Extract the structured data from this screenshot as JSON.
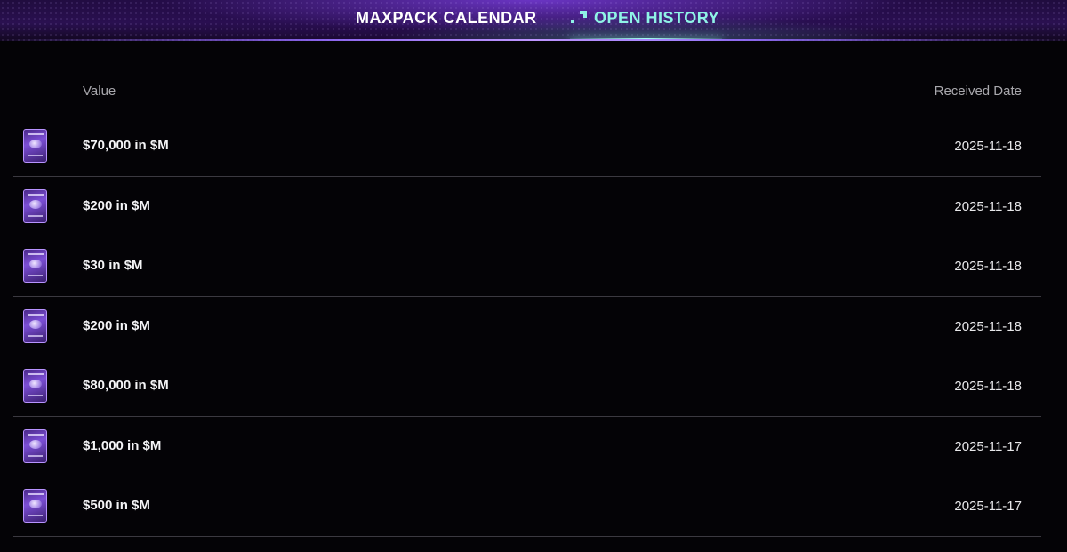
{
  "nav": {
    "tabs": [
      {
        "label": "MAXPACK CALENDAR",
        "active": false
      },
      {
        "label": "OPEN HISTORY",
        "active": true
      }
    ],
    "accent_color": "#8ff3e6",
    "brand_color": "#7c4fd6"
  },
  "table": {
    "headers": {
      "value": "Value",
      "date": "Received Date"
    },
    "rows": [
      {
        "value": "$70,000 in $M",
        "date": "2025-11-18",
        "icon": "pack-card-icon"
      },
      {
        "value": "$200 in $M",
        "date": "2025-11-18",
        "icon": "pack-card-icon"
      },
      {
        "value": "$30 in $M",
        "date": "2025-11-18",
        "icon": "pack-card-icon"
      },
      {
        "value": "$200 in $M",
        "date": "2025-11-18",
        "icon": "pack-card-icon"
      },
      {
        "value": "$80,000 in $M",
        "date": "2025-11-18",
        "icon": "pack-card-icon"
      },
      {
        "value": "$1,000 in $M",
        "date": "2025-11-17",
        "icon": "pack-card-icon"
      },
      {
        "value": "$500 in $M",
        "date": "2025-11-17",
        "icon": "pack-card-icon"
      }
    ]
  }
}
